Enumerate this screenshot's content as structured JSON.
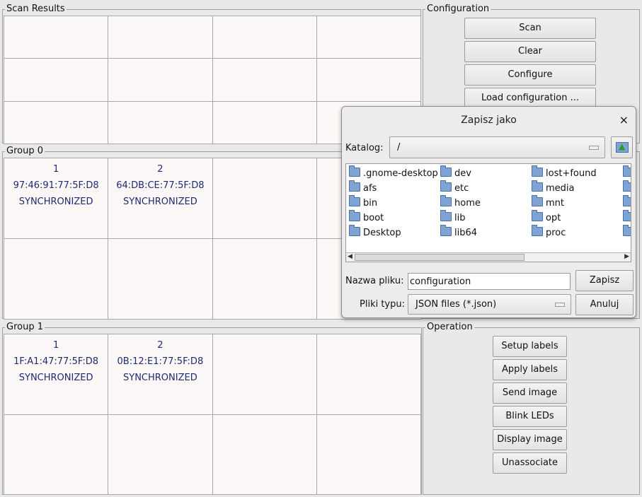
{
  "scan_results": {
    "title": "Scan Results"
  },
  "configuration": {
    "title": "Configuration",
    "buttons": [
      "Scan",
      "Clear",
      "Configure",
      "Load configuration ..."
    ]
  },
  "group0": {
    "title": "Group 0",
    "cells": [
      {
        "index": "1",
        "mac": "97:46:91:77:5F:D8",
        "status": "SYNCHRONIZED"
      },
      {
        "index": "2",
        "mac": "64:DB:CE:77:5F:D8",
        "status": "SYNCHRONIZED"
      }
    ]
  },
  "group1": {
    "title": "Group 1",
    "cells": [
      {
        "index": "1",
        "mac": "1F:A1:47:77:5F:D8",
        "status": "SYNCHRONIZED"
      },
      {
        "index": "2",
        "mac": "0B:12:E1:77:5F:D8",
        "status": "SYNCHRONIZED"
      }
    ]
  },
  "operation": {
    "title": "Operation",
    "buttons": [
      "Setup labels",
      "Apply labels",
      "Send image",
      "Blink LEDs",
      "Display image",
      "Unassociate"
    ]
  },
  "dialog": {
    "title": "Zapisz jako",
    "close": "×",
    "directory_label": "Katalog:",
    "directory_value": "/",
    "files": [
      ".gnome-desktop",
      "afs",
      "bin",
      "boot",
      "Desktop",
      "dev",
      "etc",
      "home",
      "lib",
      "lib64",
      "lost+found",
      "media",
      "mnt",
      "opt",
      "proc"
    ],
    "filename_label": "Nazwa pliku:",
    "filename_value": "configuration",
    "save_button": "Zapisz",
    "filetype_label": "Pliki typu:",
    "filetype_value": "JSON files (*.json)",
    "cancel_button": "Anuluj"
  }
}
